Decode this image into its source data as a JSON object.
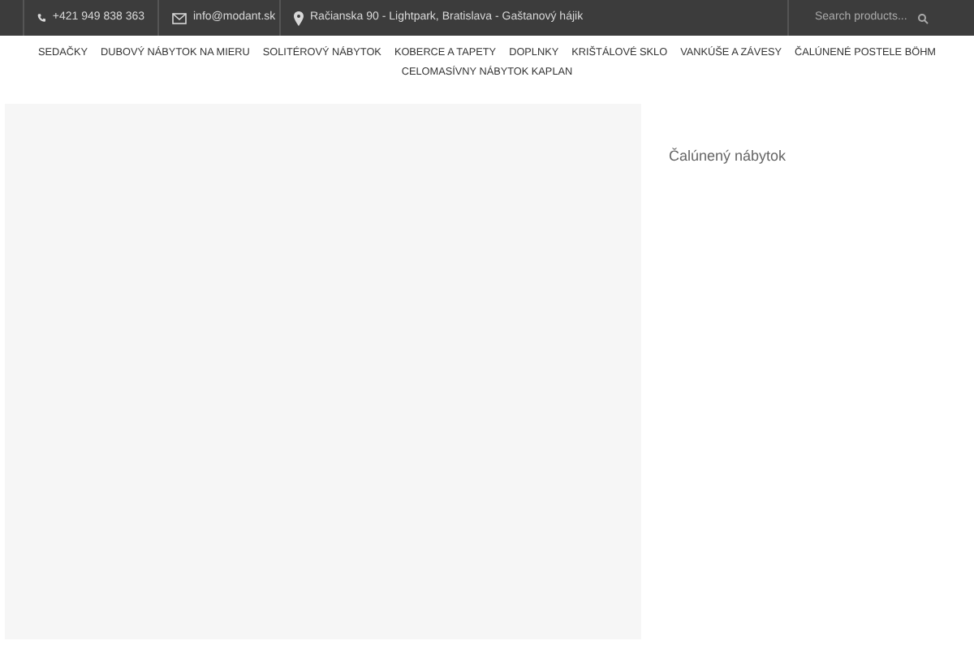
{
  "top_bar": {
    "phone": "+421 949 838 363",
    "email": "info@modant.sk",
    "address": "Račianska 90 - Lightpark, Bratislava - Gaštanový hájik",
    "search": {
      "placeholder": "Search products..."
    }
  },
  "nav": {
    "items": [
      {
        "label": "SEDAČKY"
      },
      {
        "label": "DUBOVÝ NÁBYTOK NA MIERU"
      },
      {
        "label": "SOLITÉROVÝ NÁBYTOK"
      },
      {
        "label": "KOBERCE A TAPETY"
      },
      {
        "label": "DOPLNKY"
      },
      {
        "label": "KRIŠTÁLOVÉ SKLO"
      },
      {
        "label": "VANKÚŠE A ZÁVESY"
      },
      {
        "label": "ČALÚNENÉ POSTELE BÖHM"
      },
      {
        "label": "CELOMASÍVNY NÁBYTOK KAPLAN"
      }
    ]
  },
  "sidebar": {
    "title": "Čalúnený nábytok"
  }
}
